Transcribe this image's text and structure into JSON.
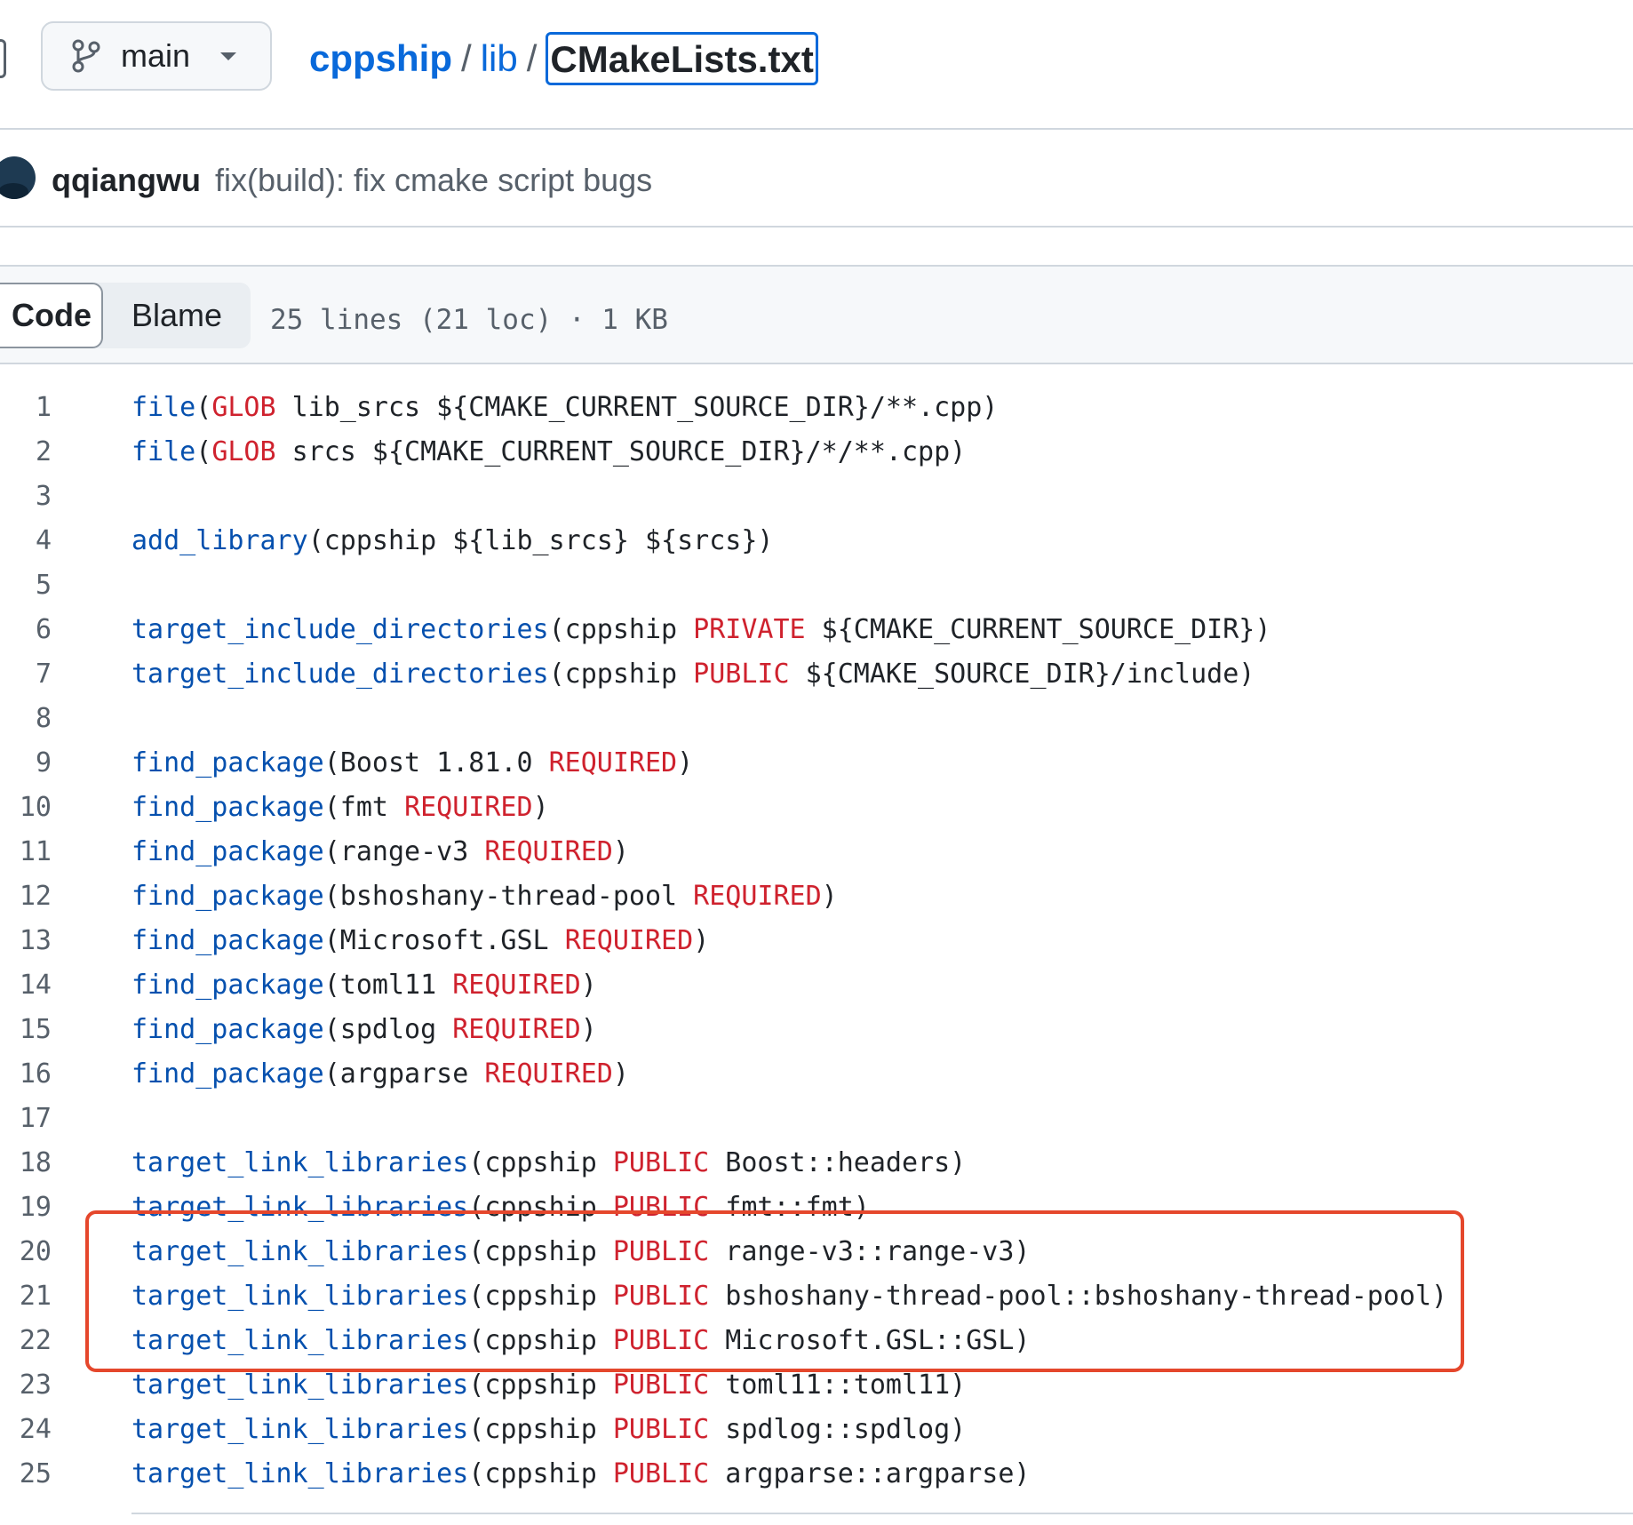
{
  "branch": {
    "name": "main"
  },
  "breadcrumb": {
    "repo": "cppship",
    "sep1": "/",
    "dir": "lib",
    "sep2": "/",
    "file": "CMakeLists.txt"
  },
  "commit": {
    "author": "qqiangwu",
    "message": "fix(build): fix cmake script bugs"
  },
  "tabs": {
    "code": "Code",
    "blame": "Blame"
  },
  "file_info": "25 lines (21 loc) · 1 KB",
  "colors": {
    "accent": "#0969da",
    "function": "#0550ae",
    "keyword": "#cf222e",
    "highlight_box": "#e5472c"
  },
  "code_lines": [
    {
      "n": "1",
      "tokens": [
        [
          "fn",
          "file"
        ],
        [
          "tx",
          "("
        ],
        [
          "kw",
          "GLOB"
        ],
        [
          "tx",
          " lib_srcs ${CMAKE_CURRENT_SOURCE_DIR}/**.cpp)"
        ]
      ]
    },
    {
      "n": "2",
      "tokens": [
        [
          "fn",
          "file"
        ],
        [
          "tx",
          "("
        ],
        [
          "kw",
          "GLOB"
        ],
        [
          "tx",
          " srcs ${CMAKE_CURRENT_SOURCE_DIR}/*/**.cpp)"
        ]
      ]
    },
    {
      "n": "3",
      "tokens": []
    },
    {
      "n": "4",
      "tokens": [
        [
          "fn",
          "add_library"
        ],
        [
          "tx",
          "(cppship ${lib_srcs} ${srcs})"
        ]
      ]
    },
    {
      "n": "5",
      "tokens": []
    },
    {
      "n": "6",
      "tokens": [
        [
          "fn",
          "target_include_directories"
        ],
        [
          "tx",
          "(cppship "
        ],
        [
          "kw",
          "PRIVATE"
        ],
        [
          "tx",
          " ${CMAKE_CURRENT_SOURCE_DIR})"
        ]
      ]
    },
    {
      "n": "7",
      "tokens": [
        [
          "fn",
          "target_include_directories"
        ],
        [
          "tx",
          "(cppship "
        ],
        [
          "kw",
          "PUBLIC"
        ],
        [
          "tx",
          " ${CMAKE_SOURCE_DIR}/include)"
        ]
      ]
    },
    {
      "n": "8",
      "tokens": []
    },
    {
      "n": "9",
      "tokens": [
        [
          "fn",
          "find_package"
        ],
        [
          "tx",
          "(Boost 1.81.0 "
        ],
        [
          "kw",
          "REQUIRED"
        ],
        [
          "tx",
          ")"
        ]
      ]
    },
    {
      "n": "10",
      "tokens": [
        [
          "fn",
          "find_package"
        ],
        [
          "tx",
          "(fmt "
        ],
        [
          "kw",
          "REQUIRED"
        ],
        [
          "tx",
          ")"
        ]
      ]
    },
    {
      "n": "11",
      "tokens": [
        [
          "fn",
          "find_package"
        ],
        [
          "tx",
          "(range-v3 "
        ],
        [
          "kw",
          "REQUIRED"
        ],
        [
          "tx",
          ")"
        ]
      ]
    },
    {
      "n": "12",
      "tokens": [
        [
          "fn",
          "find_package"
        ],
        [
          "tx",
          "(bshoshany-thread-pool "
        ],
        [
          "kw",
          "REQUIRED"
        ],
        [
          "tx",
          ")"
        ]
      ]
    },
    {
      "n": "13",
      "tokens": [
        [
          "fn",
          "find_package"
        ],
        [
          "tx",
          "(Microsoft.GSL "
        ],
        [
          "kw",
          "REQUIRED"
        ],
        [
          "tx",
          ")"
        ]
      ]
    },
    {
      "n": "14",
      "tokens": [
        [
          "fn",
          "find_package"
        ],
        [
          "tx",
          "(toml11 "
        ],
        [
          "kw",
          "REQUIRED"
        ],
        [
          "tx",
          ")"
        ]
      ]
    },
    {
      "n": "15",
      "tokens": [
        [
          "fn",
          "find_package"
        ],
        [
          "tx",
          "(spdlog "
        ],
        [
          "kw",
          "REQUIRED"
        ],
        [
          "tx",
          ")"
        ]
      ]
    },
    {
      "n": "16",
      "tokens": [
        [
          "fn",
          "find_package"
        ],
        [
          "tx",
          "(argparse "
        ],
        [
          "kw",
          "REQUIRED"
        ],
        [
          "tx",
          ")"
        ]
      ]
    },
    {
      "n": "17",
      "tokens": []
    },
    {
      "n": "18",
      "tokens": [
        [
          "fn",
          "target_link_libraries"
        ],
        [
          "tx",
          "(cppship "
        ],
        [
          "kw",
          "PUBLIC"
        ],
        [
          "tx",
          " Boost::headers)"
        ]
      ]
    },
    {
      "n": "19",
      "tokens": [
        [
          "fn",
          "target_link_libraries"
        ],
        [
          "tx",
          "(cppship "
        ],
        [
          "kw",
          "PUBLIC"
        ],
        [
          "tx",
          " fmt::fmt)"
        ]
      ]
    },
    {
      "n": "20",
      "tokens": [
        [
          "fn",
          "target_link_libraries"
        ],
        [
          "tx",
          "(cppship "
        ],
        [
          "kw",
          "PUBLIC"
        ],
        [
          "tx",
          " range-v3::range-v3)"
        ]
      ]
    },
    {
      "n": "21",
      "tokens": [
        [
          "fn",
          "target_link_libraries"
        ],
        [
          "tx",
          "(cppship "
        ],
        [
          "kw",
          "PUBLIC"
        ],
        [
          "tx",
          " bshoshany-thread-pool::bshoshany-thread-pool)"
        ]
      ]
    },
    {
      "n": "22",
      "tokens": [
        [
          "fn",
          "target_link_libraries"
        ],
        [
          "tx",
          "(cppship "
        ],
        [
          "kw",
          "PUBLIC"
        ],
        [
          "tx",
          " Microsoft.GSL::GSL)"
        ]
      ]
    },
    {
      "n": "23",
      "tokens": [
        [
          "fn",
          "target_link_libraries"
        ],
        [
          "tx",
          "(cppship "
        ],
        [
          "kw",
          "PUBLIC"
        ],
        [
          "tx",
          " toml11::toml11)"
        ]
      ]
    },
    {
      "n": "24",
      "tokens": [
        [
          "fn",
          "target_link_libraries"
        ],
        [
          "tx",
          "(cppship "
        ],
        [
          "kw",
          "PUBLIC"
        ],
        [
          "tx",
          " spdlog::spdlog)"
        ]
      ]
    },
    {
      "n": "25",
      "tokens": [
        [
          "fn",
          "target_link_libraries"
        ],
        [
          "tx",
          "(cppship "
        ],
        [
          "kw",
          "PUBLIC"
        ],
        [
          "tx",
          " argparse::argparse)"
        ]
      ]
    }
  ]
}
